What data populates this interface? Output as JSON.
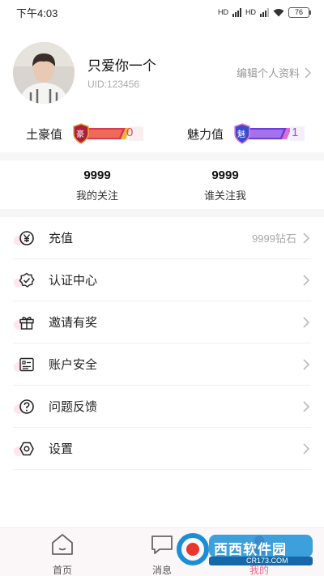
{
  "status_bar": {
    "time": "下午4:03",
    "network_1": "HD",
    "network_2": "HD",
    "battery": "76"
  },
  "profile": {
    "nickname": "只爱你一个",
    "uid": "UID:123456",
    "edit_label": "编辑个人资料"
  },
  "stats": {
    "wealth": {
      "label": "土豪值",
      "badge_char": "豪",
      "value": "0"
    },
    "charm": {
      "label": "魅力值",
      "badge_char": "魅",
      "value": "1"
    }
  },
  "follow": {
    "following": {
      "count": "9999",
      "label": "我的关注"
    },
    "followers": {
      "count": "9999",
      "label": "谁关注我"
    }
  },
  "menu": [
    {
      "label": "充值",
      "extra": "9999钻石",
      "icon": "yen-coin-icon"
    },
    {
      "label": "认证中心",
      "extra": "",
      "icon": "verified-badge-icon"
    },
    {
      "label": "邀请有奖",
      "extra": "",
      "icon": "gift-icon"
    },
    {
      "label": "账户安全",
      "extra": "",
      "icon": "security-list-icon"
    },
    {
      "label": "问题反馈",
      "extra": "",
      "icon": "question-circle-icon"
    },
    {
      "label": "设置",
      "extra": "",
      "icon": "settings-hexagon-icon"
    }
  ],
  "tabbar": {
    "home": "首页",
    "messages": "消息",
    "mine": "我的"
  },
  "watermark": {
    "brand": "西西软件园",
    "url": "CR173.COM"
  },
  "colors": {
    "accent_pink": "#e04a5e",
    "accent_purple": "#8a56e0",
    "tab_bg": "#fbf7f8"
  }
}
